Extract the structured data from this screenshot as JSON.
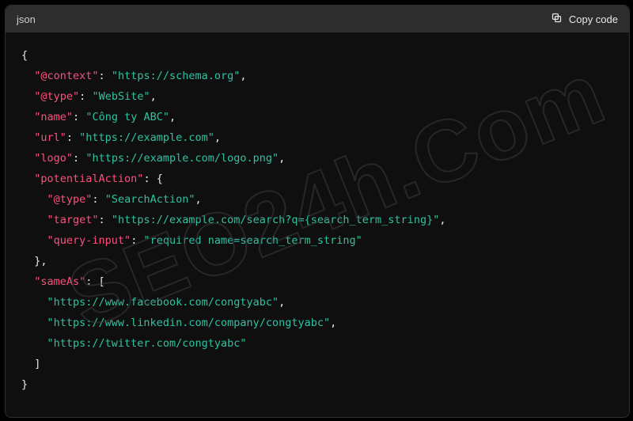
{
  "header": {
    "language_label": "json",
    "copy_label": "Copy code"
  },
  "watermark": "SEO24h.Com",
  "code": {
    "lines": [
      [
        {
          "t": "p",
          "v": "{"
        }
      ],
      [
        {
          "t": "p",
          "v": "  "
        },
        {
          "t": "k",
          "v": "\"@context\""
        },
        {
          "t": "p",
          "v": ": "
        },
        {
          "t": "s",
          "v": "\"https://schema.org\""
        },
        {
          "t": "p",
          "v": ","
        }
      ],
      [
        {
          "t": "p",
          "v": "  "
        },
        {
          "t": "k",
          "v": "\"@type\""
        },
        {
          "t": "p",
          "v": ": "
        },
        {
          "t": "s",
          "v": "\"WebSite\""
        },
        {
          "t": "p",
          "v": ","
        }
      ],
      [
        {
          "t": "p",
          "v": "  "
        },
        {
          "t": "k",
          "v": "\"name\""
        },
        {
          "t": "p",
          "v": ": "
        },
        {
          "t": "s",
          "v": "\"Công ty ABC\""
        },
        {
          "t": "p",
          "v": ","
        }
      ],
      [
        {
          "t": "p",
          "v": "  "
        },
        {
          "t": "k",
          "v": "\"url\""
        },
        {
          "t": "p",
          "v": ": "
        },
        {
          "t": "s",
          "v": "\"https://example.com\""
        },
        {
          "t": "p",
          "v": ","
        }
      ],
      [
        {
          "t": "p",
          "v": "  "
        },
        {
          "t": "k",
          "v": "\"logo\""
        },
        {
          "t": "p",
          "v": ": "
        },
        {
          "t": "s",
          "v": "\"https://example.com/logo.png\""
        },
        {
          "t": "p",
          "v": ","
        }
      ],
      [
        {
          "t": "p",
          "v": "  "
        },
        {
          "t": "k",
          "v": "\"potentialAction\""
        },
        {
          "t": "p",
          "v": ": {"
        }
      ],
      [
        {
          "t": "p",
          "v": "    "
        },
        {
          "t": "k",
          "v": "\"@type\""
        },
        {
          "t": "p",
          "v": ": "
        },
        {
          "t": "s",
          "v": "\"SearchAction\""
        },
        {
          "t": "p",
          "v": ","
        }
      ],
      [
        {
          "t": "p",
          "v": "    "
        },
        {
          "t": "k",
          "v": "\"target\""
        },
        {
          "t": "p",
          "v": ": "
        },
        {
          "t": "s",
          "v": "\"https://example.com/search?q={search_term_string}\""
        },
        {
          "t": "p",
          "v": ","
        }
      ],
      [
        {
          "t": "p",
          "v": "    "
        },
        {
          "t": "k",
          "v": "\"query-input\""
        },
        {
          "t": "p",
          "v": ": "
        },
        {
          "t": "s",
          "v": "\"required name=search_term_string\""
        }
      ],
      [
        {
          "t": "p",
          "v": "  },"
        }
      ],
      [
        {
          "t": "p",
          "v": "  "
        },
        {
          "t": "k",
          "v": "\"sameAs\""
        },
        {
          "t": "p",
          "v": ": ["
        }
      ],
      [
        {
          "t": "p",
          "v": "    "
        },
        {
          "t": "s",
          "v": "\"https://www.facebook.com/congtyabc\""
        },
        {
          "t": "p",
          "v": ","
        }
      ],
      [
        {
          "t": "p",
          "v": "    "
        },
        {
          "t": "s",
          "v": "\"https://www.linkedin.com/company/congtyabc\""
        },
        {
          "t": "p",
          "v": ","
        }
      ],
      [
        {
          "t": "p",
          "v": "    "
        },
        {
          "t": "s",
          "v": "\"https://twitter.com/congtyabc\""
        }
      ],
      [
        {
          "t": "p",
          "v": "  ]"
        }
      ],
      [
        {
          "t": "p",
          "v": "}"
        }
      ]
    ]
  }
}
